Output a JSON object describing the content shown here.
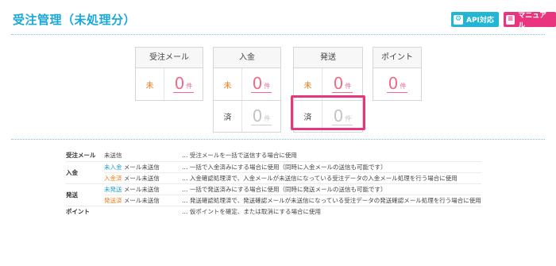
{
  "page_title": "受注管理（未処理分）",
  "buttons": {
    "api_label": "API対応",
    "api_icon": "gear-icon",
    "manual_label": "マニュアル",
    "manual_icon": "document-icon"
  },
  "colors": {
    "title": "#1aa7d9",
    "api_button": "#22b6d4",
    "manual_button": "#e8357d",
    "unsent_label": "#ef7d1c",
    "count_active": "#ef6b8a",
    "count_inactive": "#c3c3c3",
    "highlight_box": "#e8357d"
  },
  "groups": {
    "order_mail": {
      "title": "受注メール",
      "unsent": {
        "label": "未",
        "count": "0",
        "unit": "件"
      }
    },
    "payment": {
      "title": "入金",
      "unsent": {
        "label": "未",
        "count": "0",
        "unit": "件"
      },
      "done": {
        "label": "済",
        "count": "0",
        "unit": "件"
      }
    },
    "shipping": {
      "title": "発送",
      "unsent": {
        "label": "未",
        "count": "0",
        "unit": "件"
      },
      "done": {
        "label": "済",
        "count": "0",
        "unit": "件"
      }
    },
    "points": {
      "title": "ポイント",
      "count": "0",
      "unit": "件"
    }
  },
  "legend": {
    "order_mail": {
      "category": "受注メール",
      "key": "未送信",
      "desc": "… 受注メールを一括で送信する場合に使用"
    },
    "payment": {
      "category": "入金",
      "row1": {
        "key_prefix": "未入金",
        "key_suffix": " メール未送信",
        "desc": "… 一括で入金済みにする場合に使用（同時に入金メールの送信も可能です）"
      },
      "row2": {
        "key_prefix": "入金済",
        "key_suffix": " メール未送信",
        "desc": "… 入金確認処理済で、入金メールが未送信になっている受注データの入金メール処理を行う場合に使用"
      }
    },
    "shipping": {
      "category": "発送",
      "row1": {
        "key_prefix": "未発送",
        "key_suffix": " メール未送信",
        "desc": "… 一括で発送済みにする場合に使用（同時に発送メールの送信も可能です）"
      },
      "row2": {
        "key_prefix": "発送済",
        "key_suffix": " メール未送信",
        "desc": "… 発送確認処理済で、発送確認メールが未送信になっている受注データの発送確認メール処理を行う場合に使用"
      }
    },
    "points": {
      "category": "ポイント",
      "desc": "… 仮ポイントを確定、または取消にする場合に使用"
    }
  }
}
